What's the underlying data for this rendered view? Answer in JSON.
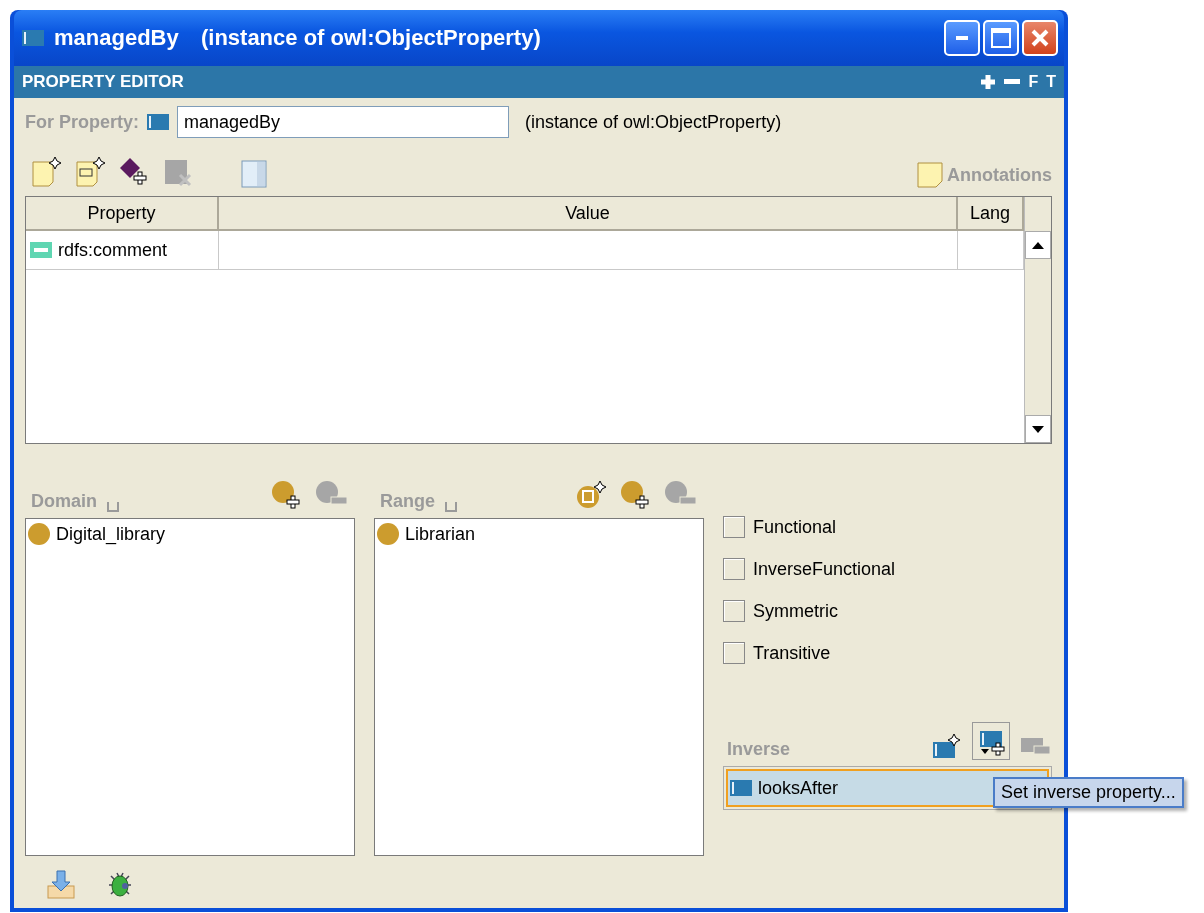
{
  "window": {
    "title": "managedBy",
    "subtitle": "(instance of owl:ObjectProperty)"
  },
  "editor": {
    "title": "PROPERTY EDITOR",
    "header_letters": [
      "F",
      "T"
    ]
  },
  "for_property": {
    "label": "For Property:",
    "value": "managedBy",
    "type_text": "(instance of owl:ObjectProperty)"
  },
  "annotations_label": "Annotations",
  "table": {
    "columns": [
      "Property",
      "Value",
      "Lang"
    ],
    "rows": [
      {
        "property": "rdfs:comment"
      }
    ]
  },
  "domain": {
    "title": "Domain",
    "items": [
      "Digital_library"
    ]
  },
  "range": {
    "title": "Range",
    "items": [
      "Librarian"
    ]
  },
  "characteristics": [
    {
      "label": "Functional",
      "checked": false
    },
    {
      "label": "InverseFunctional",
      "checked": false
    },
    {
      "label": "Symmetric",
      "checked": false
    },
    {
      "label": "Transitive",
      "checked": false
    }
  ],
  "inverse": {
    "title": "Inverse",
    "items": [
      {
        "label": "looksAfter",
        "selected": true
      }
    ]
  },
  "tooltip": "Set inverse property..."
}
